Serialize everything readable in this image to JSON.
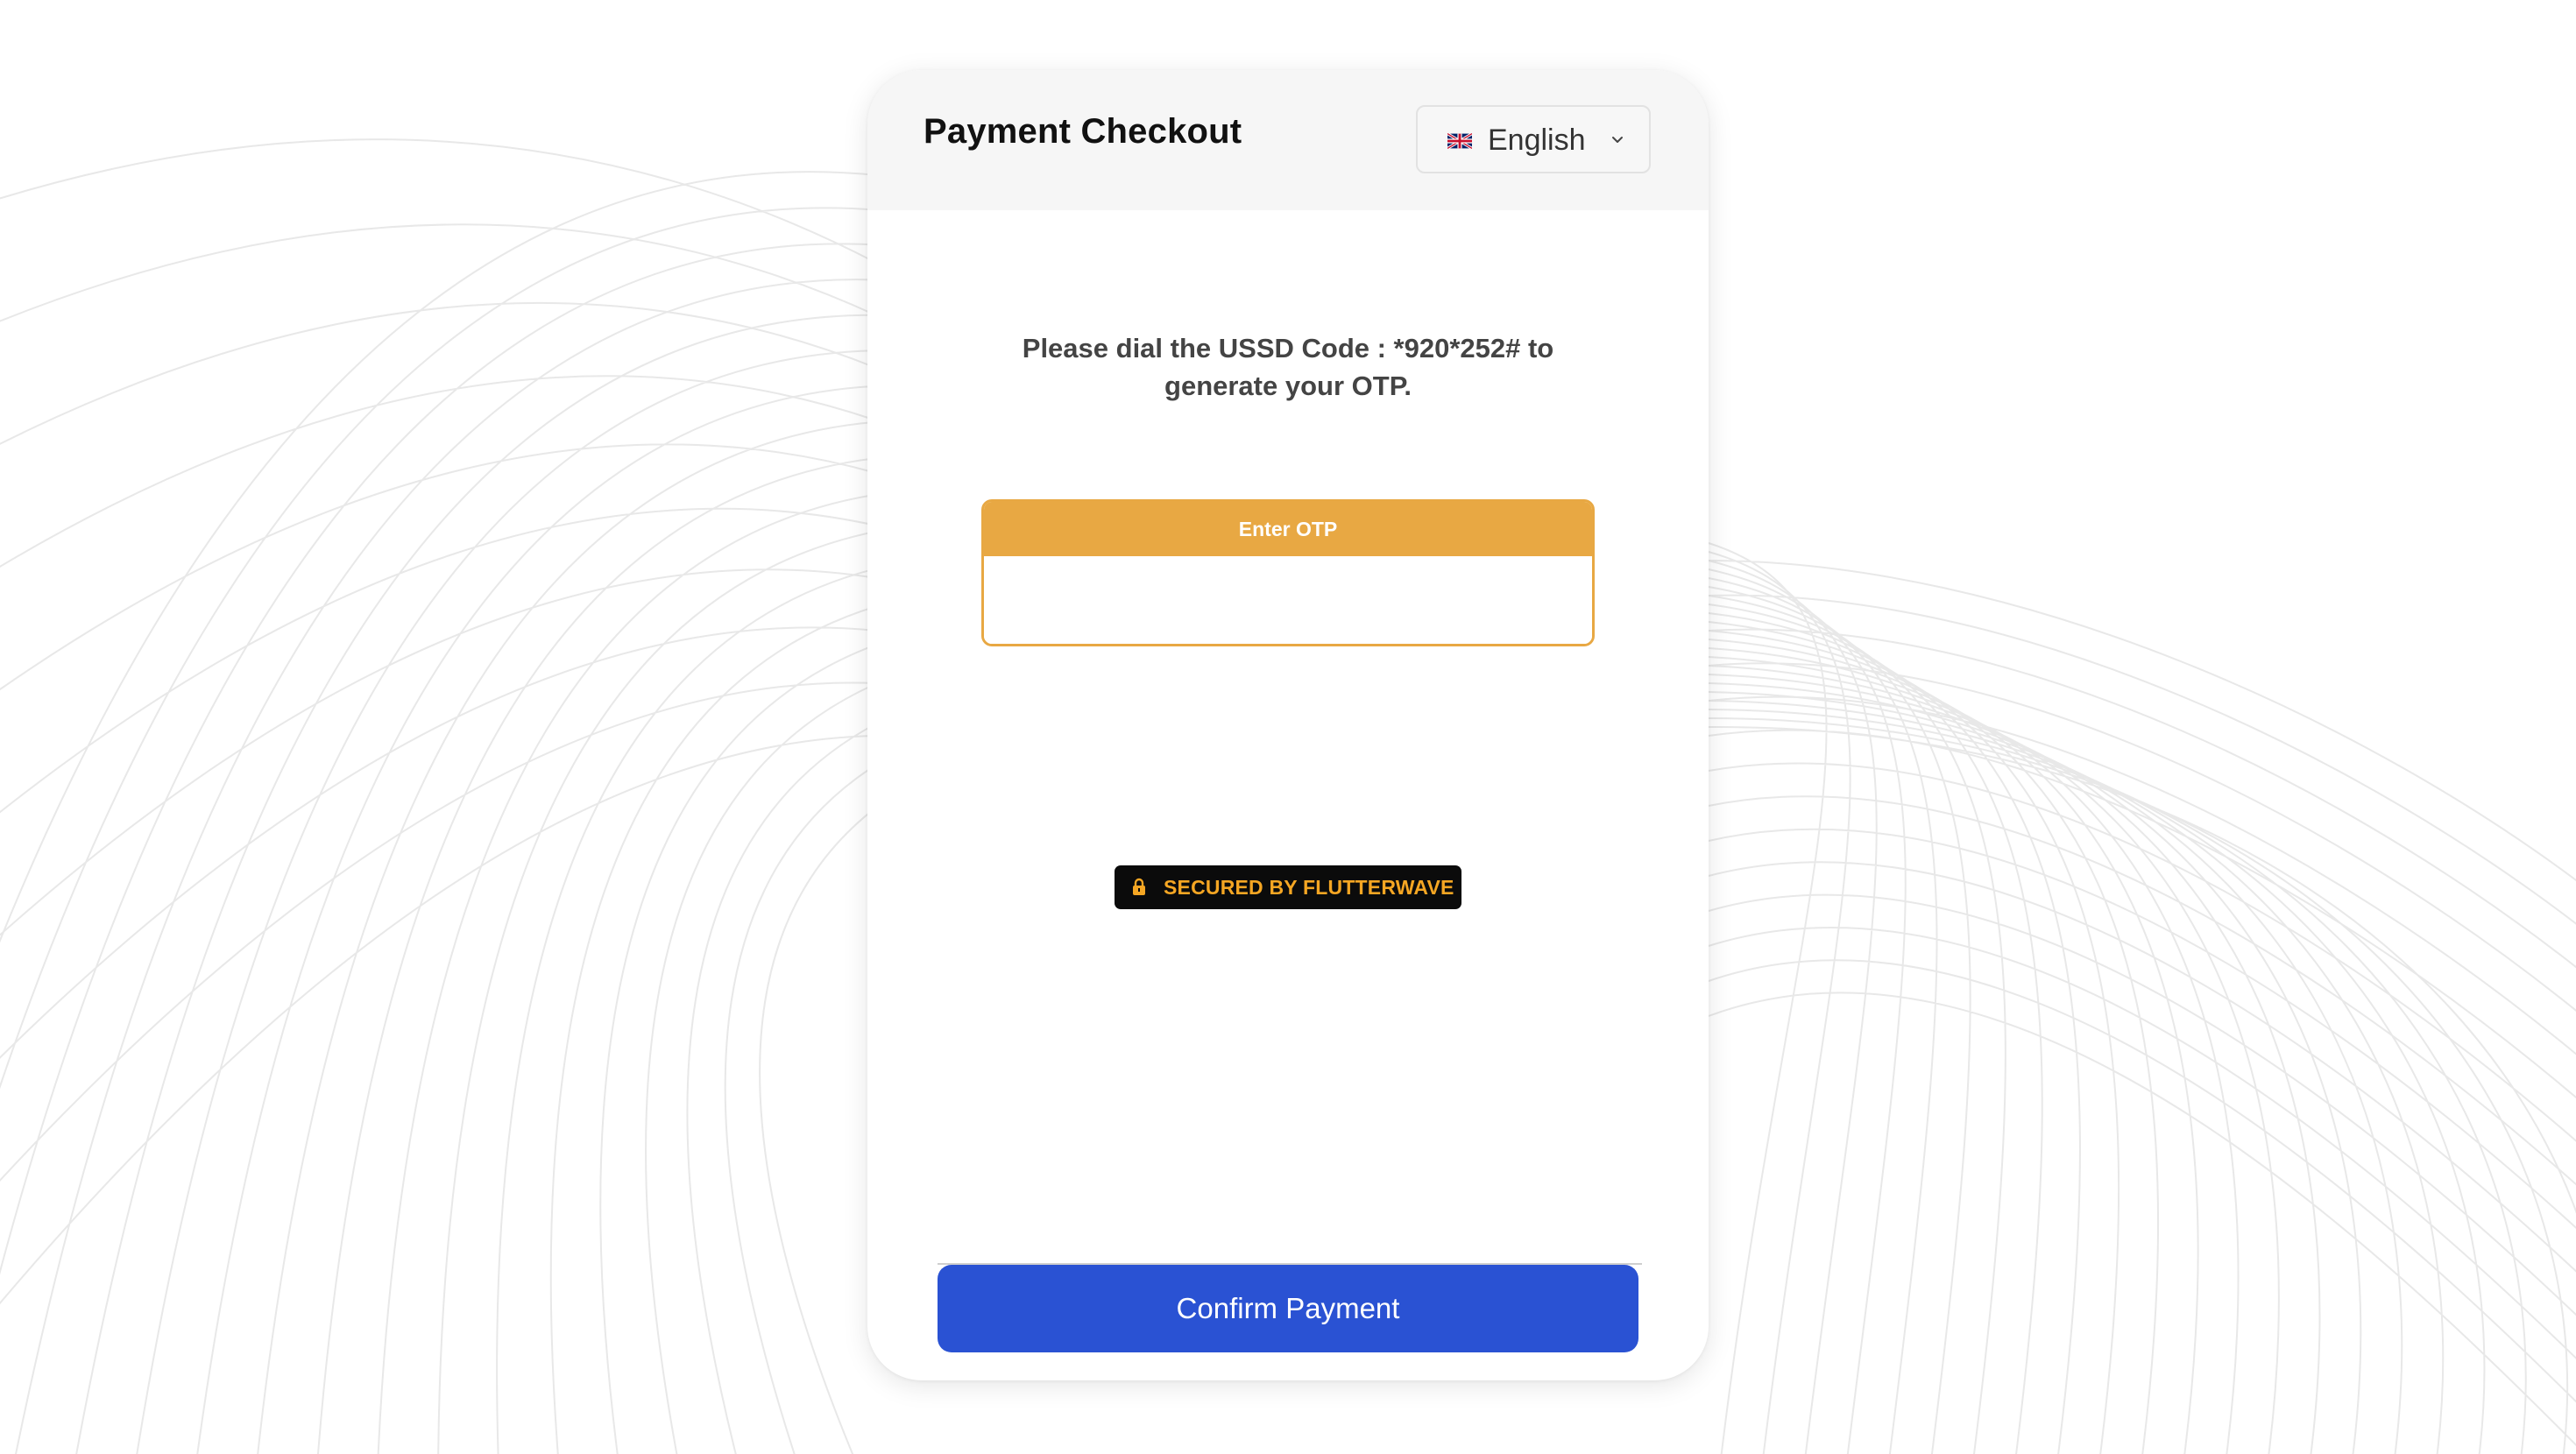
{
  "header": {
    "title": "Payment Checkout",
    "language": {
      "selected": "English",
      "flag_icon": "uk-flag-icon",
      "chevron_icon": "chevron-down-icon"
    }
  },
  "main": {
    "instruction": "Please dial the USSD Code : *920*252# to generate your OTP.",
    "otp": {
      "label": "Enter OTP",
      "value": "",
      "placeholder": ""
    },
    "secured_badge": {
      "icon": "lock-icon",
      "text": "SECURED BY FLUTTERWAVE"
    }
  },
  "footer": {
    "confirm_label": "Confirm Payment"
  },
  "colors": {
    "accent_orange": "#e8a843",
    "button_blue": "#2a52d3",
    "badge_text": "#f5a623",
    "badge_bg": "#0b0b0b",
    "header_bg": "#f6f6f6"
  }
}
